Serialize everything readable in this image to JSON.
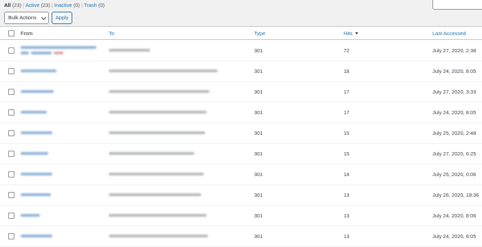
{
  "filters": {
    "all": {
      "label": "All",
      "count": "(23)"
    },
    "active": {
      "label": "Active",
      "count": "(23)"
    },
    "inactive": {
      "label": "Inactive",
      "count": "(0)"
    },
    "trash": {
      "label": "Trash",
      "count": "(0)"
    },
    "separator": "|"
  },
  "bulk": {
    "selected": "Bulk Actions",
    "apply_label": "Apply"
  },
  "columns": {
    "from": "From",
    "to": "To",
    "type": "Type",
    "hits": "Hits",
    "last_accessed": "Last Accessed"
  },
  "sort": {
    "column": "hits",
    "direction": "descending"
  },
  "rows": [
    {
      "type": "301",
      "hits": "72",
      "last_accessed": "July 27, 2020, 2:38"
    },
    {
      "type": "301",
      "hits": "18",
      "last_accessed": "July 24, 2020, 8:05"
    },
    {
      "type": "301",
      "hits": "17",
      "last_accessed": "July 27, 2020, 3:33"
    },
    {
      "type": "301",
      "hits": "17",
      "last_accessed": "July 24, 2020, 8:05"
    },
    {
      "type": "301",
      "hits": "15",
      "last_accessed": "July 25, 2020, 2:48"
    },
    {
      "type": "301",
      "hits": "15",
      "last_accessed": "July 27, 2020, 6:25"
    },
    {
      "type": "301",
      "hits": "14",
      "last_accessed": "July 25, 2020, 0:06"
    },
    {
      "type": "301",
      "hits": "13",
      "last_accessed": "July 26, 2020, 18:36"
    },
    {
      "type": "301",
      "hits": "13",
      "last_accessed": "July 24, 2020, 8:06"
    },
    {
      "type": "301",
      "hits": "13",
      "last_accessed": "July 24, 2020, 8:05"
    }
  ],
  "colors": {
    "link": "#2271b1",
    "text": "#3c434a",
    "background": "#f1f1f1"
  }
}
